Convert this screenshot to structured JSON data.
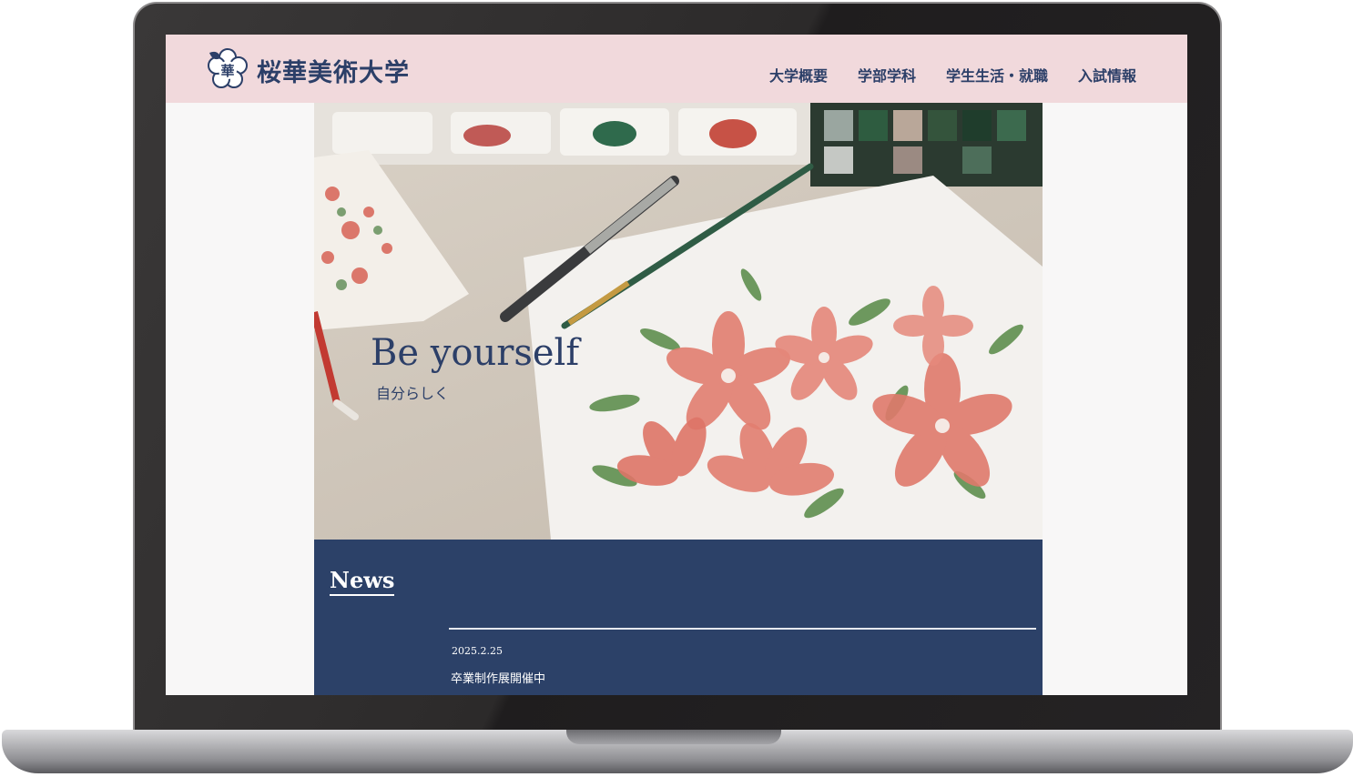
{
  "site": {
    "title": "桜華美術大学",
    "logo_mark": "華",
    "logo_icon": "sakura-blossom-icon"
  },
  "nav": {
    "items": [
      {
        "label": "大学概要"
      },
      {
        "label": "学部学科"
      },
      {
        "label": "学生生活・就職"
      },
      {
        "label": "入試情報"
      }
    ]
  },
  "hero": {
    "title": "Be yourself",
    "subtitle": "自分らしく"
  },
  "news": {
    "heading": "News",
    "items": [
      {
        "date": "2025.2.25",
        "headline": "卒業制作展開催中"
      }
    ]
  },
  "colors": {
    "brand_navy": "#2c4168",
    "header_pink": "#f1d9dc",
    "flower_coral": "#e07a6c"
  }
}
